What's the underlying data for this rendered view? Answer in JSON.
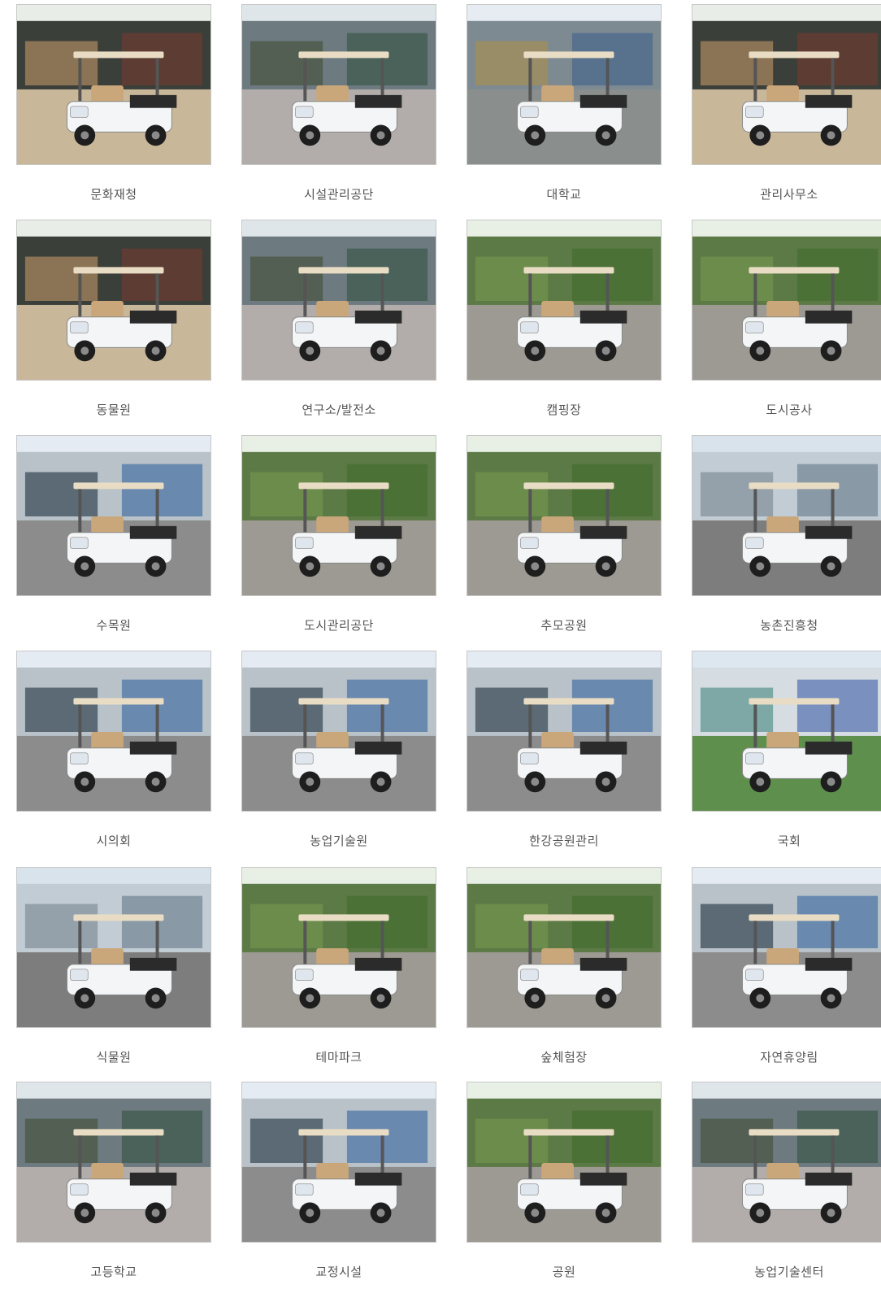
{
  "gallery": {
    "items": [
      {
        "caption": "문화재청",
        "scene": "palace"
      },
      {
        "caption": "시설관리공단",
        "scene": "street"
      },
      {
        "caption": "대학교",
        "scene": "campus"
      },
      {
        "caption": "관리사무소",
        "scene": "palace"
      },
      {
        "caption": "동물원",
        "scene": "palace"
      },
      {
        "caption": "연구소/발전소",
        "scene": "street"
      },
      {
        "caption": "캠핑장",
        "scene": "park"
      },
      {
        "caption": "도시공사",
        "scene": "park"
      },
      {
        "caption": "수목원",
        "scene": "building"
      },
      {
        "caption": "도시관리공단",
        "scene": "park"
      },
      {
        "caption": "추모공원",
        "scene": "park"
      },
      {
        "caption": "농촌진흥청",
        "scene": "greenhouse"
      },
      {
        "caption": "시의회",
        "scene": "building"
      },
      {
        "caption": "농업기술원",
        "scene": "building"
      },
      {
        "caption": "한강공원관리",
        "scene": "building"
      },
      {
        "caption": "국회",
        "scene": "assembly"
      },
      {
        "caption": "식물원",
        "scene": "greenhouse"
      },
      {
        "caption": "테마파크",
        "scene": "park"
      },
      {
        "caption": "숲체험장",
        "scene": "park"
      },
      {
        "caption": "자연휴양림",
        "scene": "building"
      },
      {
        "caption": "고등학교",
        "scene": "street"
      },
      {
        "caption": "교정시설",
        "scene": "building"
      },
      {
        "caption": "공원",
        "scene": "park"
      },
      {
        "caption": "농업기술센터",
        "scene": "street"
      }
    ]
  }
}
